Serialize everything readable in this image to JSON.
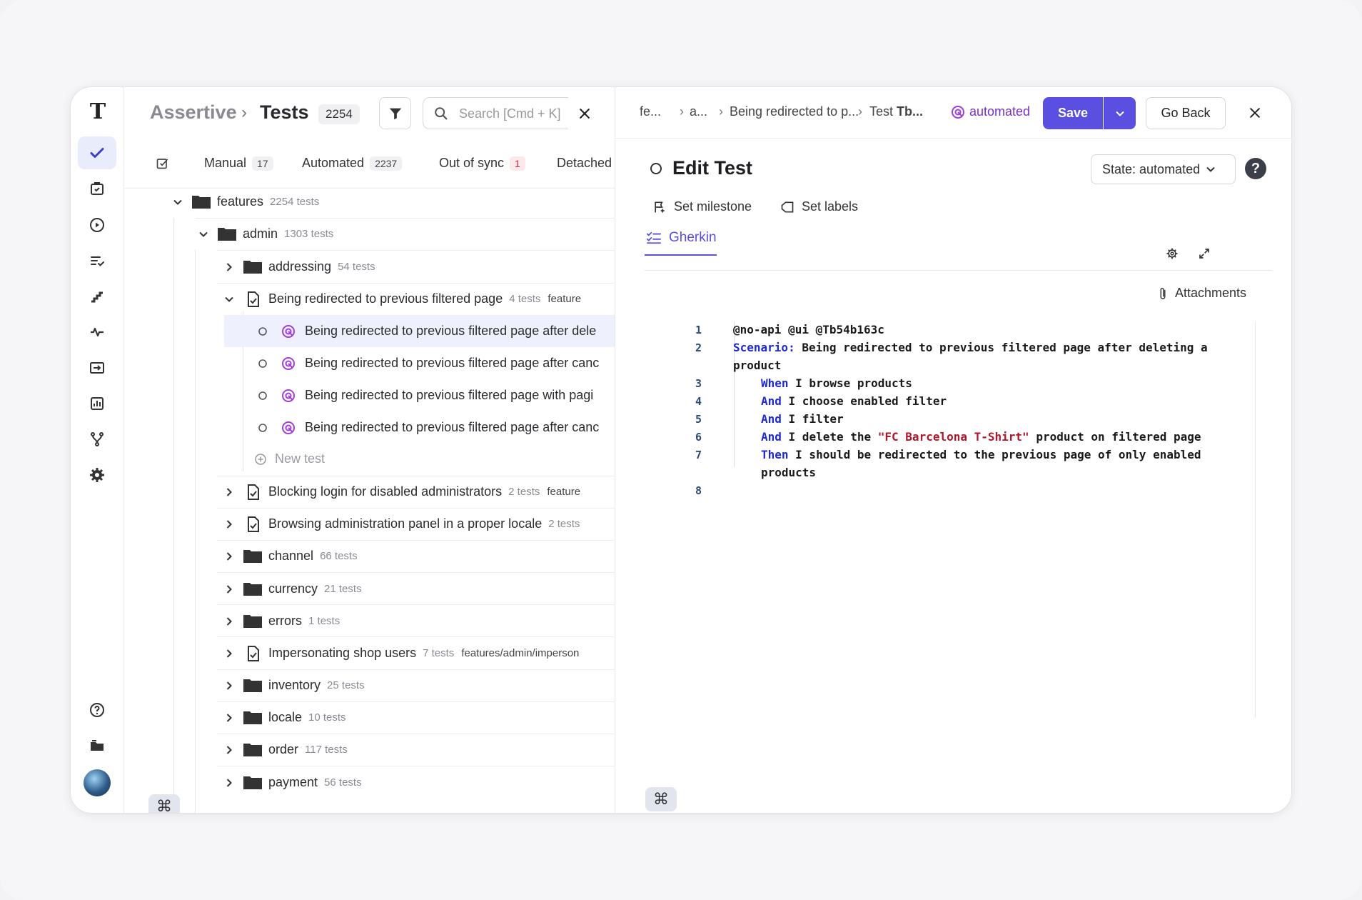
{
  "app": {
    "project": "Assertive",
    "section": "Tests",
    "total_count": "2254"
  },
  "search": {
    "placeholder": "Search [Cmd + K]"
  },
  "tabs": [
    {
      "label": "Manual",
      "count": "17"
    },
    {
      "label": "Automated",
      "count": "2237"
    },
    {
      "label": "Out of sync",
      "count": "1"
    },
    {
      "label": "Detached",
      "count": ""
    }
  ],
  "tree": {
    "features": {
      "label": "features",
      "count": "2254 tests"
    },
    "admin": {
      "label": "admin",
      "count": "1303 tests"
    },
    "addressing": {
      "label": "addressing",
      "count": "54 tests"
    },
    "redirected_suite": {
      "label": "Being redirected to previous filtered page",
      "count": "4 tests",
      "path": "feature"
    },
    "tests": [
      "Being redirected to previous filtered page after dele",
      "Being redirected to previous filtered page after canc",
      "Being redirected to previous filtered page with pagi",
      "Being redirected to previous filtered page after canc"
    ],
    "new_test": "New test",
    "blocking": {
      "label": "Blocking login for disabled administrators",
      "count": "2 tests",
      "path": "feature"
    },
    "browsing": {
      "label": "Browsing administration panel in a proper locale",
      "count": "2 tests"
    },
    "channel": {
      "label": "channel",
      "count": "66 tests"
    },
    "currency": {
      "label": "currency",
      "count": "21 tests"
    },
    "errors": {
      "label": "errors",
      "count": "1 tests"
    },
    "impersonating": {
      "label": "Impersonating shop users",
      "count": "7 tests",
      "path": "features/admin/imperson"
    },
    "inventory": {
      "label": "inventory",
      "count": "25 tests"
    },
    "locale": {
      "label": "locale",
      "count": "10 tests"
    },
    "order": {
      "label": "order",
      "count": "117 tests"
    },
    "payment": {
      "label": "payment",
      "count": "56 tests"
    }
  },
  "editor": {
    "breadcrumb": [
      "fe...",
      "a...",
      "Being redirected to p...",
      "Test"
    ],
    "breadcrumb_bold": "Tb...",
    "status_badge": "automated",
    "save_label": "Save",
    "go_back_label": "Go Back",
    "title": "Edit Test",
    "state_label": "State: automated",
    "help": "?",
    "set_milestone": "Set milestone",
    "set_labels": "Set labels",
    "gherkin_tab": "Gherkin",
    "attachments": "Attachments",
    "line_numbers": [
      "1",
      "2",
      "3",
      "4",
      "5",
      "6",
      "7",
      "8"
    ],
    "code": {
      "l1": "@no-api @ui @Tb54b163c",
      "l2_kw": "Scenario:",
      "l2_text": " Being redirected to previous filtered page after deleting a",
      "l2_wrap": "product",
      "l3_kw": "When",
      "l3_text": " I browse products",
      "l4_kw": "And",
      "l4_text": " I choose enabled filter",
      "l5_kw": "And",
      "l5_text": " I filter",
      "l6_kw": "And",
      "l6_text_a": " I delete the ",
      "l6_str": "\"FC Barcelona T-Shirt\"",
      "l6_text_b": " product on filtered page",
      "l7_kw": "Then",
      "l7_text": " I should be redirected to the previous page of only enabled",
      "l7_wrap": "products"
    }
  },
  "cmd_key": "⌘",
  "colors": {
    "accent": "#5a4fe0",
    "automated": "#7b2fbd",
    "keyword": "#1e2ad0",
    "string": "#b1152a"
  }
}
